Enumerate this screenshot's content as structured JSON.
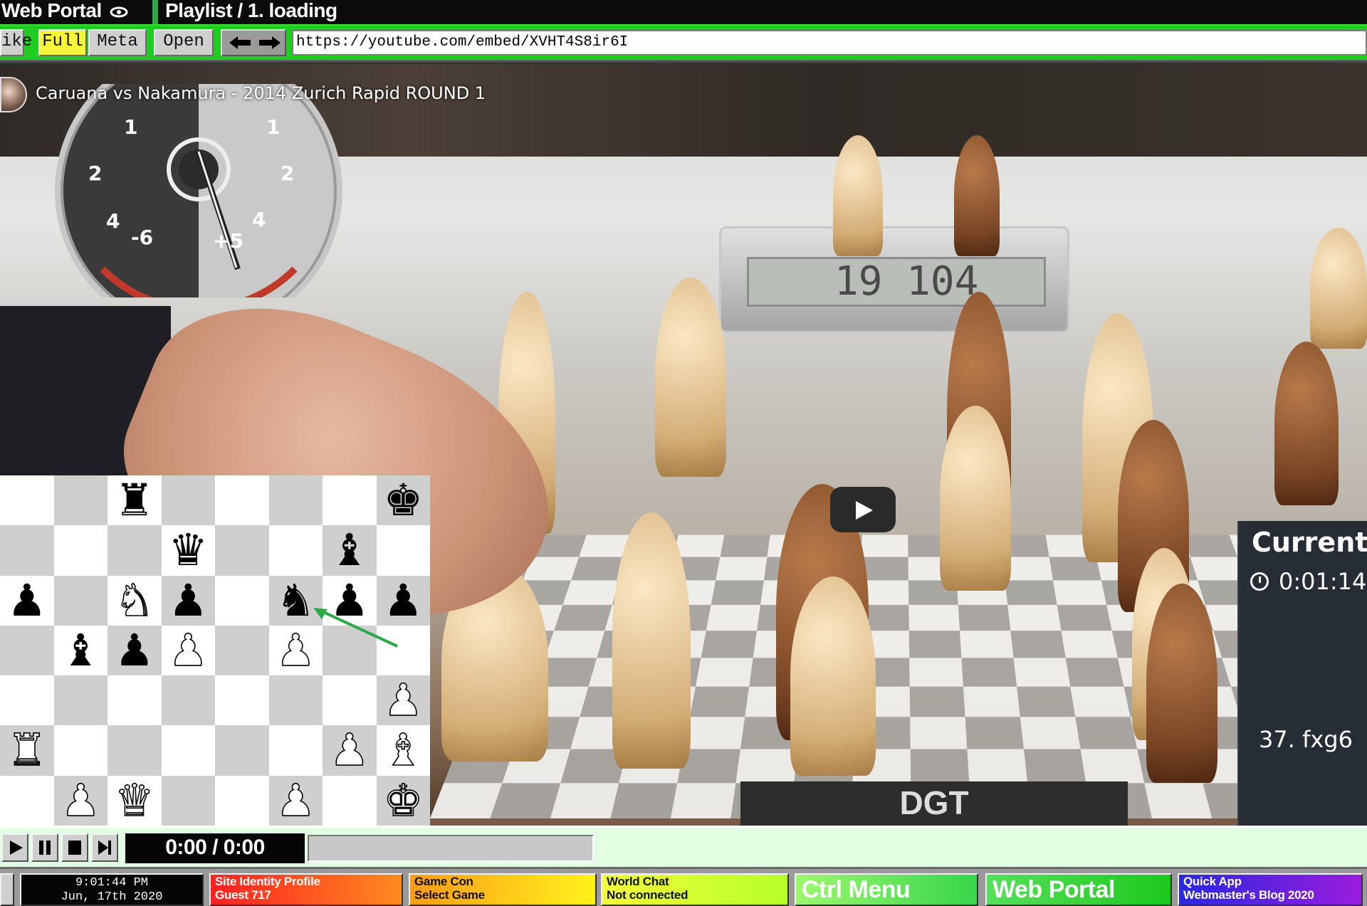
{
  "title_bar": {
    "left_title": "Web Portal",
    "right_title": "Playlist / 1. loading"
  },
  "toolbar": {
    "partial_label": "ike",
    "full_label": "Full",
    "meta_label": "Meta",
    "open_label": "Open",
    "url": "https://youtube.com/embed/XVHT4S8ir6I"
  },
  "video": {
    "title": "Caruana vs Nakamura - 2014 Zurich Rapid ROUND 1",
    "gauge_ticks": [
      "1",
      "2",
      "4",
      "-6",
      "1",
      "2",
      "4",
      "+5"
    ],
    "clock_display": "19   104",
    "board_brand": "DGT",
    "current_panel": {
      "title": "Current",
      "time": "0:01:14",
      "move": "37. fxg6"
    }
  },
  "board2d": {
    "pieces": [
      {
        "row": 0,
        "col": 2,
        "glyph": "♜",
        "color": "black"
      },
      {
        "row": 0,
        "col": 7,
        "glyph": "♚",
        "color": "black"
      },
      {
        "row": 1,
        "col": 3,
        "glyph": "♛",
        "color": "black"
      },
      {
        "row": 1,
        "col": 6,
        "glyph": "♝",
        "color": "black"
      },
      {
        "row": 2,
        "col": 0,
        "glyph": "♟",
        "color": "black"
      },
      {
        "row": 2,
        "col": 2,
        "glyph": "♞",
        "color": "white"
      },
      {
        "row": 2,
        "col": 3,
        "glyph": "♟",
        "color": "black"
      },
      {
        "row": 2,
        "col": 5,
        "glyph": "♞",
        "color": "black"
      },
      {
        "row": 2,
        "col": 6,
        "glyph": "♟",
        "color": "black"
      },
      {
        "row": 2,
        "col": 7,
        "glyph": "♟",
        "color": "black"
      },
      {
        "row": 3,
        "col": 1,
        "glyph": "♝",
        "color": "black"
      },
      {
        "row": 3,
        "col": 2,
        "glyph": "♟",
        "color": "black"
      },
      {
        "row": 3,
        "col": 3,
        "glyph": "♟",
        "color": "white"
      },
      {
        "row": 3,
        "col": 5,
        "glyph": "♟",
        "color": "white"
      },
      {
        "row": 4,
        "col": 7,
        "glyph": "♟",
        "color": "white"
      },
      {
        "row": 5,
        "col": 0,
        "glyph": "♜",
        "color": "white"
      },
      {
        "row": 5,
        "col": 6,
        "glyph": "♟",
        "color": "white"
      },
      {
        "row": 5,
        "col": 7,
        "glyph": "♝",
        "color": "white"
      },
      {
        "row": 6,
        "col": 1,
        "glyph": "♟",
        "color": "white"
      },
      {
        "row": 6,
        "col": 2,
        "glyph": "♛",
        "color": "white"
      },
      {
        "row": 6,
        "col": 5,
        "glyph": "♟",
        "color": "white"
      },
      {
        "row": 6,
        "col": 7,
        "glyph": "♚",
        "color": "white"
      }
    ]
  },
  "player": {
    "time": "0:00 / 0:00",
    "progress": 0
  },
  "taskbar": {
    "clock_time": "9:01:44 PM",
    "clock_date": "Jun, 17th 2020",
    "site_line1": "Site Identity  Profile",
    "site_line2": "Guest 717",
    "game_line1": "Game Con",
    "game_line2": "Select Game",
    "chat_line1": "World Chat",
    "chat_line2": "Not connected",
    "ctrl_label": "Ctrl  Menu",
    "web_label": "Web Portal",
    "quick_line1": "Quick App",
    "quick_line2": "Webmaster's Blog 2020"
  },
  "colors": {
    "toolbar_green": "#1fcc1f",
    "accent_yellow": "#f5f53a",
    "panel_dark": "#272d35"
  }
}
